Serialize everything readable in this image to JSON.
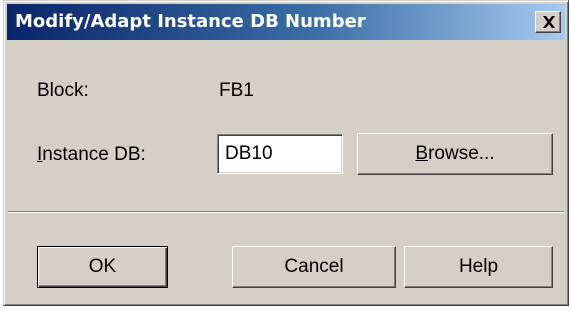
{
  "window": {
    "title": "Modify/Adapt Instance DB Number",
    "close_icon": "close-icon"
  },
  "form": {
    "block_label": "Block:",
    "block_value": "FB1",
    "instance_db_label": "Instance DB:",
    "instance_db_value": "DB10"
  },
  "buttons": {
    "browse": "Browse...",
    "ok": "OK",
    "cancel": "Cancel",
    "help": "Help"
  }
}
